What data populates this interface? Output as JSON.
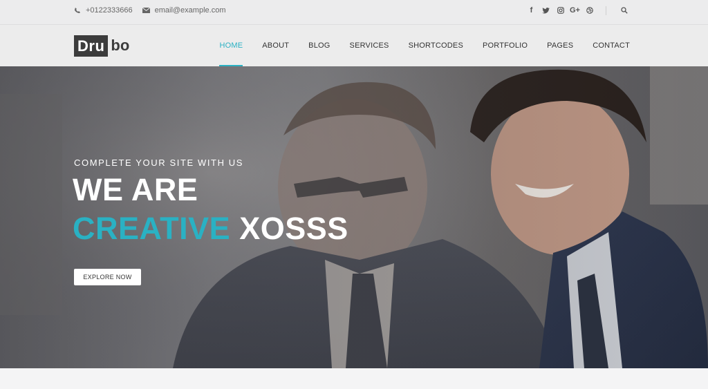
{
  "topbar": {
    "phone": "+0122333666",
    "email": "email@example.com",
    "social": [
      {
        "icon": "facebook-icon",
        "glyph": "f"
      },
      {
        "icon": "twitter-icon",
        "glyph": "t"
      },
      {
        "icon": "instagram-icon",
        "glyph": "ig"
      },
      {
        "icon": "google-plus-icon",
        "glyph": "G+"
      },
      {
        "icon": "dribbble-icon",
        "glyph": "d"
      }
    ]
  },
  "header": {
    "logo_box": "Dru",
    "logo_rest": "bo",
    "nav": [
      "HOME",
      "ABOUT",
      "BLOG",
      "SERVICES",
      "SHORTCODES",
      "PORTFOLIO",
      "PAGES",
      "CONTACT"
    ],
    "active_index": 0
  },
  "hero": {
    "subtitle": "COMPLETE YOUR SITE WITH US",
    "line1": "WE ARE",
    "line2_accent": "CREATIVE",
    "line2_rest": "XOSSS",
    "button": "EXPLORE NOW"
  },
  "colors": {
    "accent": "#2ab1c3",
    "logo_bg": "#3c3c3c"
  }
}
